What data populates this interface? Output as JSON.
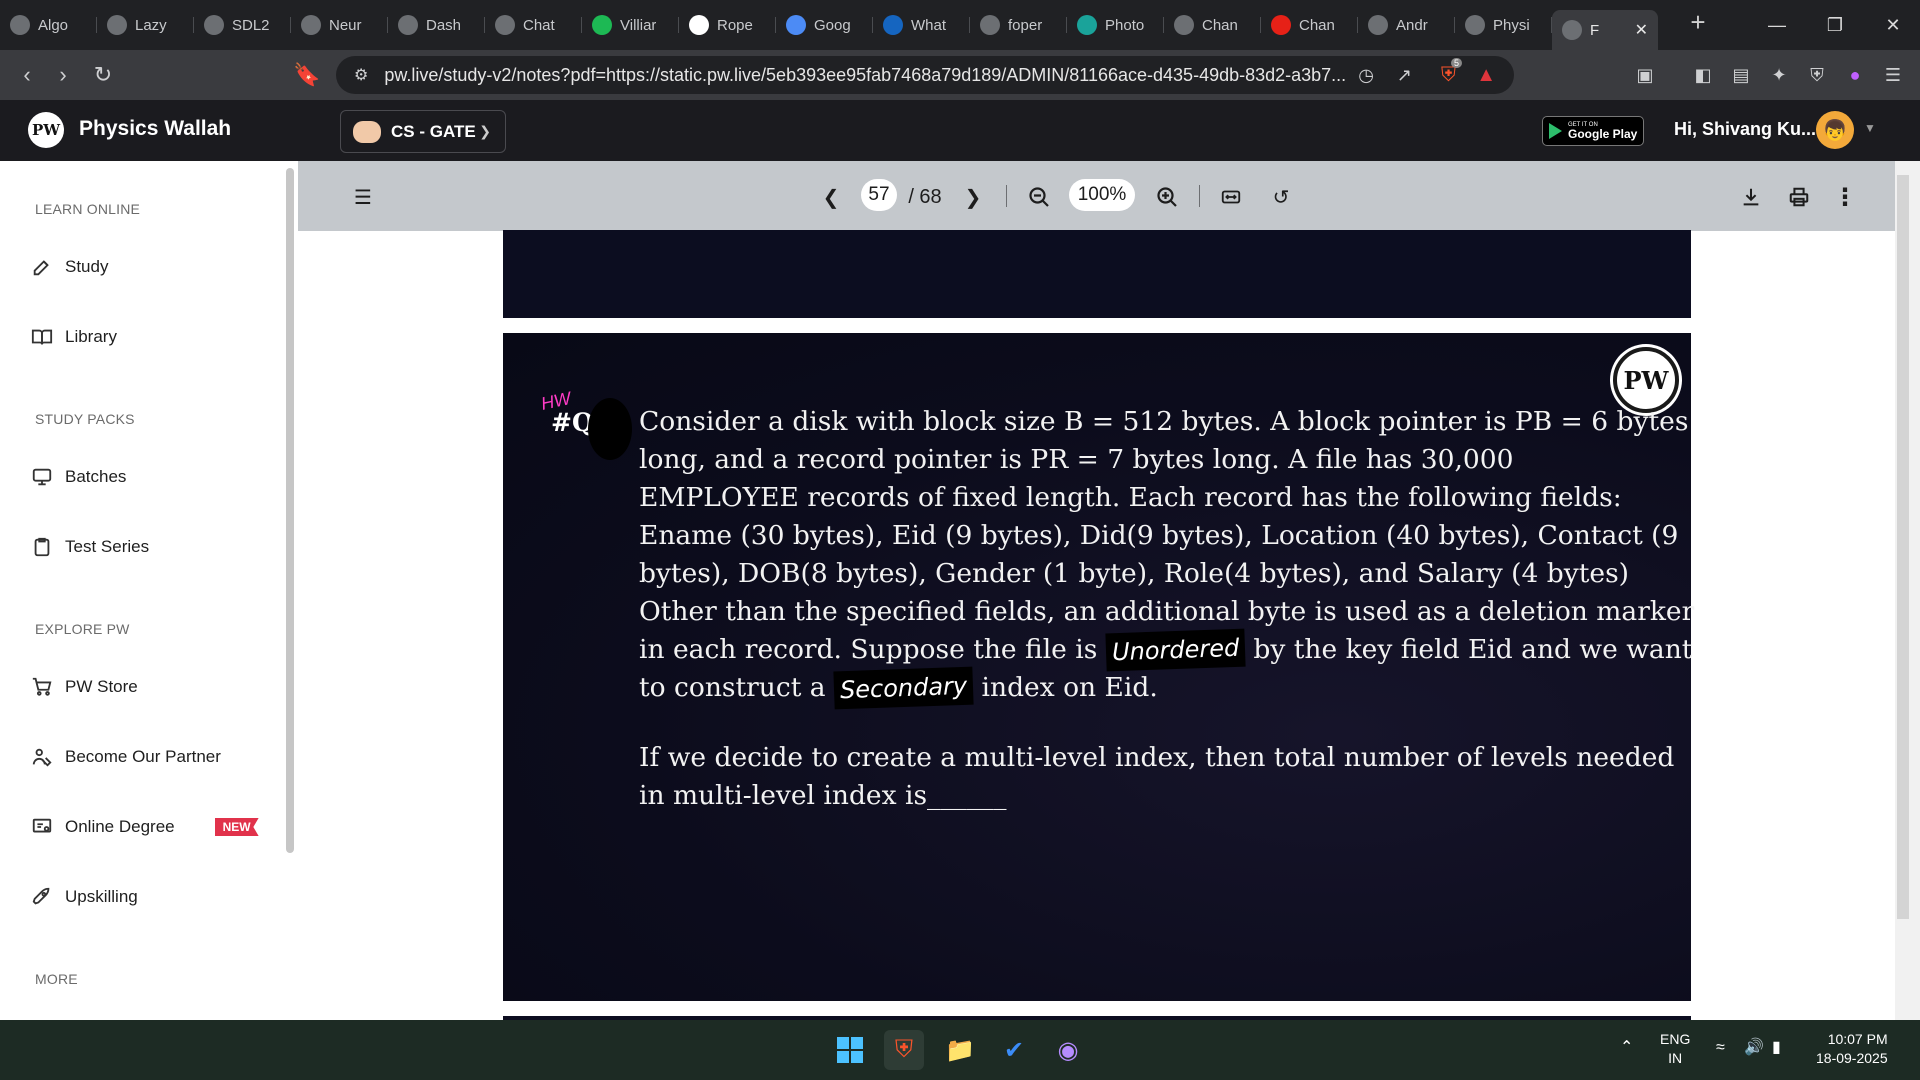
{
  "browser": {
    "tabs": [
      {
        "label": "Algo",
        "icon": "web-icon",
        "color": "#6c6f73"
      },
      {
        "label": "Lazy",
        "icon": "globe-icon",
        "color": "#6c6f73"
      },
      {
        "label": "SDL2",
        "icon": "web-icon",
        "color": "#6c6f73"
      },
      {
        "label": "Neur",
        "icon": "globe-icon",
        "color": "#6c6f73"
      },
      {
        "label": "Dash",
        "icon": "web-icon",
        "color": "#6c6f73"
      },
      {
        "label": "Chat",
        "icon": "openai-icon",
        "color": "#6c6f73"
      },
      {
        "label": "Villiar",
        "icon": "spotify-icon",
        "color": "#1db954"
      },
      {
        "label": "Rope",
        "icon": "wikipedia-icon",
        "color": "#ffffff"
      },
      {
        "label": "Goog",
        "icon": "gemini-icon",
        "color": "#4c8bf5"
      },
      {
        "label": "What",
        "icon": "web-icon",
        "color": "#1565c0"
      },
      {
        "label": "foper",
        "icon": "globe-icon",
        "color": "#6c6f73"
      },
      {
        "label": "Photo",
        "icon": "web-icon",
        "color": "#1aa39a"
      },
      {
        "label": "Chan",
        "icon": "globe-icon",
        "color": "#6c6f73"
      },
      {
        "label": "Chan",
        "icon": "youtube-icon",
        "color": "#e62117"
      },
      {
        "label": "Andr",
        "icon": "openai-icon",
        "color": "#6c6f73"
      },
      {
        "label": "Physi",
        "icon": "web-icon",
        "color": "#6c6f73"
      },
      {
        "label": "F",
        "icon": "web-icon",
        "color": "#6c6f73",
        "active": true
      }
    ],
    "url": "pw.live/study-v2/notes?pdf=https://static.pw.live/5eb393ee95fab7468a79d189/ADMIN/81166ace-d435-49db-83d2-a3b7...",
    "shield_count": "5"
  },
  "header": {
    "brand": "Physics Wallah",
    "logo_text": "PW",
    "batch": "CS - GATE",
    "play_top": "GET IT ON",
    "play_bottom": "Google Play",
    "greeting": "Hi, Shivang Ku..."
  },
  "sidebar": {
    "sections": [
      "LEARN ONLINE",
      "STUDY PACKS",
      "EXPLORE PW",
      "MORE"
    ],
    "items": [
      {
        "label": "Study",
        "icon": "edit-icon"
      },
      {
        "label": "Library",
        "icon": "book-icon"
      },
      {
        "label": "Batches",
        "icon": "monitor-icon"
      },
      {
        "label": "Test Series",
        "icon": "clipboard-icon"
      },
      {
        "label": "PW Store",
        "icon": "cart-icon"
      },
      {
        "label": "Become Our Partner",
        "icon": "partner-icon"
      },
      {
        "label": "Online Degree",
        "icon": "degree-icon",
        "badge": "NEW"
      },
      {
        "label": "Upskilling",
        "icon": "rocket-icon"
      }
    ]
  },
  "pdf": {
    "page_current": "57",
    "page_total": "/ 68",
    "zoom": "100%"
  },
  "question": {
    "hw": "HW",
    "qlabel": "#Q",
    "lines": [
      "Consider a disk with block size B = 512 bytes. A block pointer is PB = 6 bytes",
      "long, and a record pointer is PR = 7 bytes long. A file has 30,000",
      "EMPLOYEE records of fixed length. Each record has the following fields:",
      "Ename (30 bytes), Eid (9 bytes), Did(9 bytes), Location (40 bytes), Contact (9",
      "bytes), DOB(8 bytes), Gender (1 byte), Role(4 bytes), and Salary (4 bytes)",
      "Other than the specified fields, an additional byte is used as a deletion  marker"
    ],
    "line7_a": "in each record. Suppose the file is ",
    "hand1": "Unordered",
    "line7_b": " by the  key field Eid    and we want",
    "line8_a": "to construct a ",
    "hand2": "Secondary",
    "line8_b": " index on Eid.",
    "para2_l1": "If we decide to create a multi-level index, then total number of levels needed",
    "para2_l2": "in multi-level index is______"
  },
  "taskbar": {
    "lang1": "ENG",
    "lang2": "IN",
    "time": "10:07 PM",
    "date": "18-09-2025"
  },
  "colors": {
    "pw_header": "#1b1b1f",
    "pdf_toolbar": "#c4c8cc",
    "badge": "#e1324b",
    "taskbar": "#1d2b24"
  }
}
